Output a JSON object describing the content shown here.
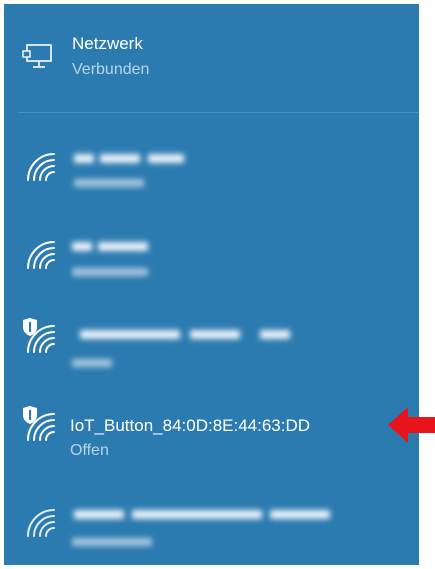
{
  "network": {
    "title": "Netzwerk",
    "status": "Verbunden",
    "icon": "desktop-ethernet-icon"
  },
  "wifi_list": [
    {
      "name": "",
      "status": "",
      "blurred": true,
      "secured": false,
      "icon": "wifi-icon"
    },
    {
      "name": "",
      "status": "",
      "blurred": true,
      "secured": false,
      "icon": "wifi-icon"
    },
    {
      "name": "",
      "status": "",
      "blurred": true,
      "secured": true,
      "icon": "wifi-shield-icon"
    },
    {
      "name": "IoT_Button_84:0D:8E:44:63:DD",
      "status": "Offen",
      "blurred": false,
      "secured": true,
      "icon": "wifi-shield-icon"
    },
    {
      "name": "",
      "status": "",
      "blurred": true,
      "secured": false,
      "icon": "wifi-icon"
    }
  ],
  "colors": {
    "panel_bg": "#2c7bb0",
    "text_primary": "#ffffff",
    "text_secondary": "#b8d4e8",
    "arrow": "#e8141c"
  },
  "annotation": {
    "icon": "red-arrow-left-icon"
  }
}
